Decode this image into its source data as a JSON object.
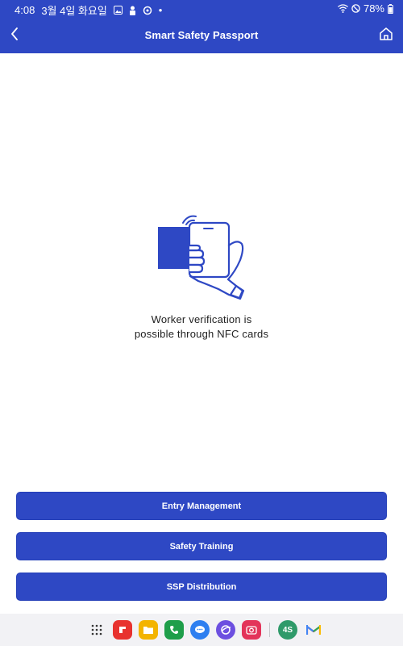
{
  "status_bar": {
    "time": "4:08",
    "date": "3월 4일 화요일",
    "battery": "78%"
  },
  "app_bar": {
    "title": "Smart Safety Passport",
    "back_icon": "chevron-left-icon",
    "home_icon": "home-icon"
  },
  "main": {
    "message_line1": "Worker verification is",
    "message_line2": "possible through NFC cards",
    "illustration_icon": "nfc-card-tap-icon"
  },
  "actions": [
    {
      "label": "Entry Management"
    },
    {
      "label": "Safety Training"
    },
    {
      "label": "SSP Distribution"
    }
  ],
  "dock": {
    "apps": [
      "apps-grid-icon",
      "flipboard-icon",
      "files-icon",
      "phone-icon",
      "messages-icon",
      "internet-icon",
      "camera-icon",
      "4s-app-icon",
      "gmail-icon"
    ],
    "fourS_label": "4S"
  },
  "colors": {
    "brand": "#2e48c4",
    "text": "#222222",
    "background": "#ffffff"
  }
}
